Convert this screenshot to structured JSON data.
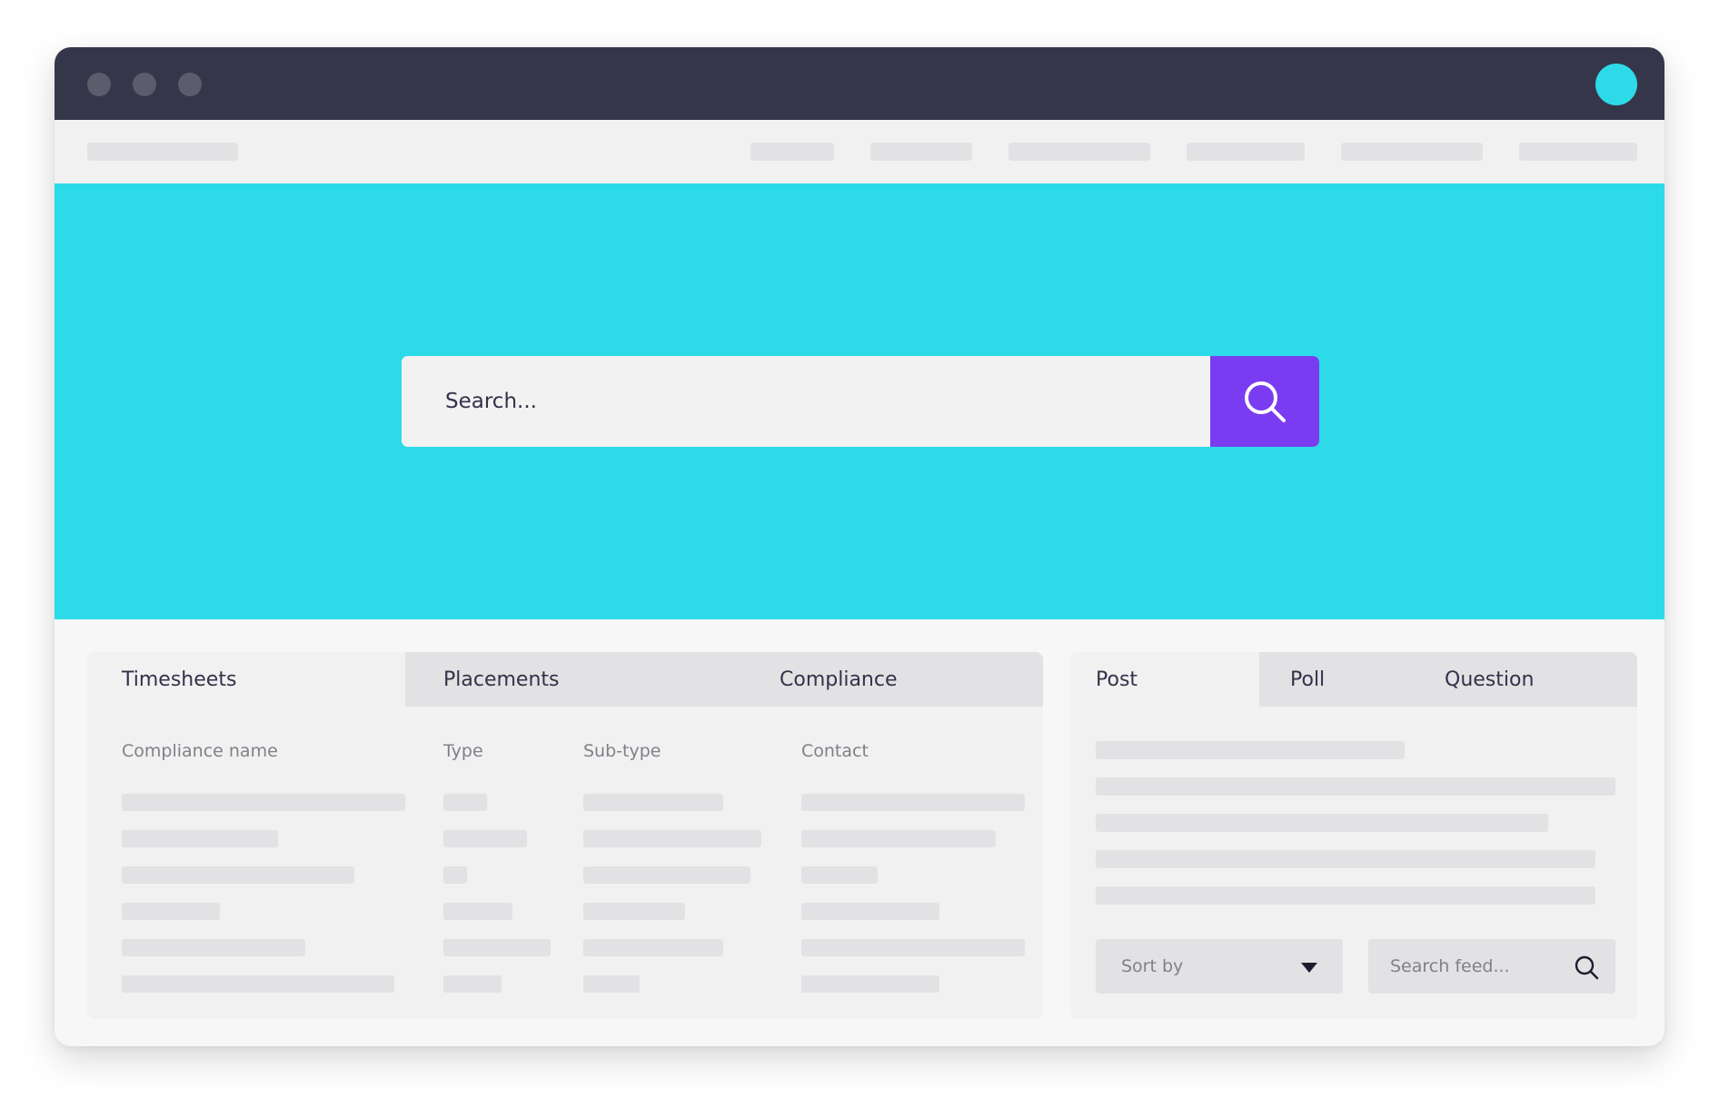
{
  "colors": {
    "titlebar": "#36364b",
    "accent_cyan": "#2ddbe8",
    "accent_purple": "#7a3cf0",
    "placeholder_bar": "#e2e2e4"
  },
  "icons": {
    "window_controls": [
      "close-dot",
      "minimize-dot",
      "maximize-dot"
    ],
    "search": "search-icon",
    "dropdown": "caret-down-icon"
  },
  "hero": {
    "search_placeholder": "Search..."
  },
  "left_panel": {
    "tabs": [
      {
        "label": "Timesheets",
        "active": true
      },
      {
        "label": "Placements",
        "active": false
      },
      {
        "label": "Compliance",
        "active": false
      }
    ],
    "columns": [
      "Compliance name",
      "Type",
      "Sub-type",
      "Contact"
    ],
    "row_count": 6
  },
  "right_panel": {
    "tabs": [
      {
        "label": "Post",
        "active": true
      },
      {
        "label": "Poll",
        "active": false
      },
      {
        "label": "Question",
        "active": false
      }
    ],
    "sort_label": "Sort by",
    "feed_search_placeholder": "Search feed..."
  }
}
